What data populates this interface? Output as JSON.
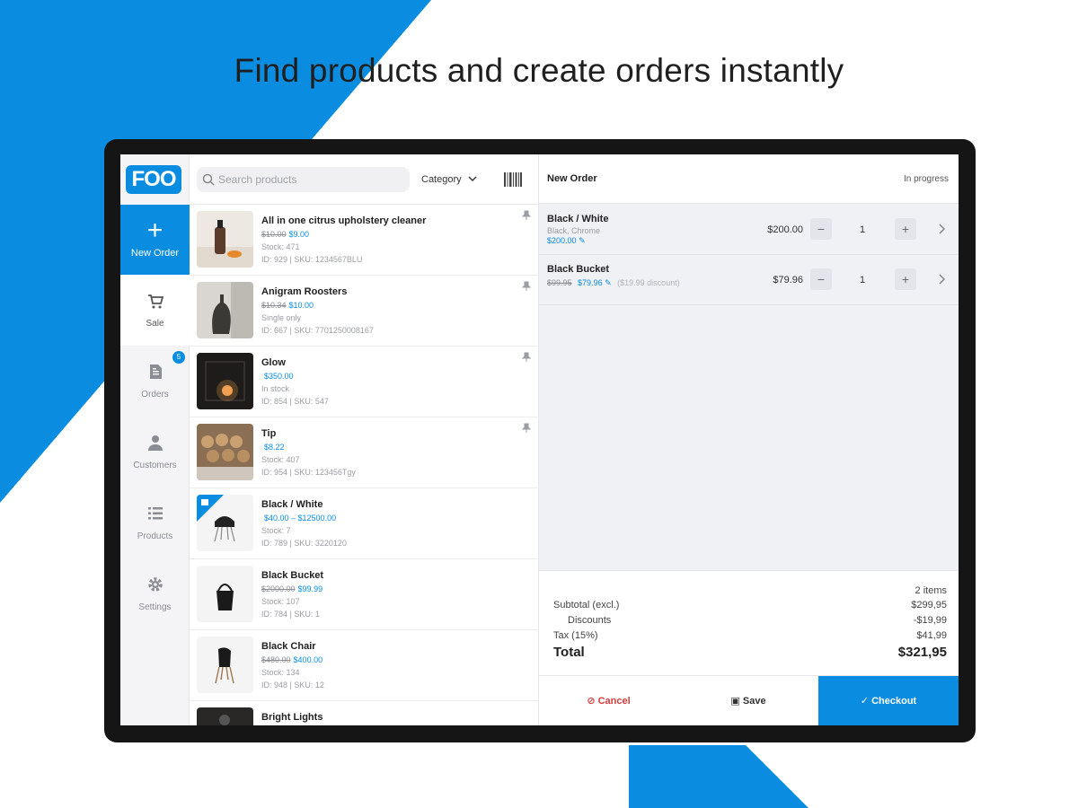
{
  "headline": "Find products and create orders instantly",
  "brand": {
    "logo_text": "FOO",
    "accent": "#0a8de0"
  },
  "sidebar": {
    "new_order": "New Order",
    "items": [
      {
        "label": "Sale",
        "icon": "cart-icon"
      },
      {
        "label": "Orders",
        "icon": "orders-icon",
        "badge": "5"
      },
      {
        "label": "Customers",
        "icon": "person-icon"
      },
      {
        "label": "Products",
        "icon": "list-icon"
      },
      {
        "label": "Settings",
        "icon": "gear-icon"
      }
    ]
  },
  "search": {
    "placeholder": "Search products",
    "category_label": "Category"
  },
  "products": [
    {
      "name": "All in one citrus upholstery cleaner",
      "old_price": "$10.00",
      "price": "$9.00",
      "stock": "Stock: 471",
      "meta": "ID: 929 | SKU: 1234567BLU"
    },
    {
      "name": "Anigram Roosters",
      "old_price": "$10.34",
      "price": "$10.00",
      "stock": "Single only",
      "meta": "ID: 667 | SKU: 7701250008167"
    },
    {
      "name": "Glow",
      "old_price": "",
      "price": "$350.00",
      "stock": "In stock",
      "meta": "ID: 854 | SKU: 547"
    },
    {
      "name": "Tip",
      "old_price": "",
      "price": "$8.22",
      "stock": "Stock: 407",
      "meta": "ID: 954 | SKU: 123456Tgy"
    },
    {
      "name": "Black / White",
      "old_price": "",
      "price": "$40.00 – $12500.00",
      "stock": "Stock: 7",
      "meta": "ID: 789 | SKU: 3220120"
    },
    {
      "name": "Black Bucket",
      "old_price": "$2000.00",
      "price": "$99.99",
      "stock": "Stock: 107",
      "meta": "ID: 784 | SKU: 1"
    },
    {
      "name": "Black Chair",
      "old_price": "$480.00",
      "price": "$400.00",
      "stock": "Stock: 134",
      "meta": "ID: 948 | SKU: 12"
    },
    {
      "name": "Bright Lights",
      "old_price": "",
      "price": "",
      "stock": "",
      "meta": ""
    }
  ],
  "order": {
    "title": "New Order",
    "status": "In progress",
    "lines": [
      {
        "name": "Black / White",
        "variant": "Black, Chrome",
        "sub_price": "$200.00",
        "price": "$200.00",
        "qty": "1"
      },
      {
        "name": "Black Bucket",
        "variant": "",
        "old_price": "$99.95",
        "sub_price": "$79.96",
        "discount": "($19.99 discount)",
        "price": "$79.96",
        "qty": "1"
      }
    ],
    "totals": {
      "items": "2 items",
      "subtotal_label": "Subtotal (excl.)",
      "subtotal": "$299,95",
      "discounts_label": "Discounts",
      "discounts": "-$19,99",
      "tax_label": "Tax (15%)",
      "tax": "$41,99",
      "total_label": "Total",
      "total": "$321,95"
    },
    "actions": {
      "cancel": "Cancel",
      "save": "Save",
      "checkout": "Checkout"
    }
  }
}
